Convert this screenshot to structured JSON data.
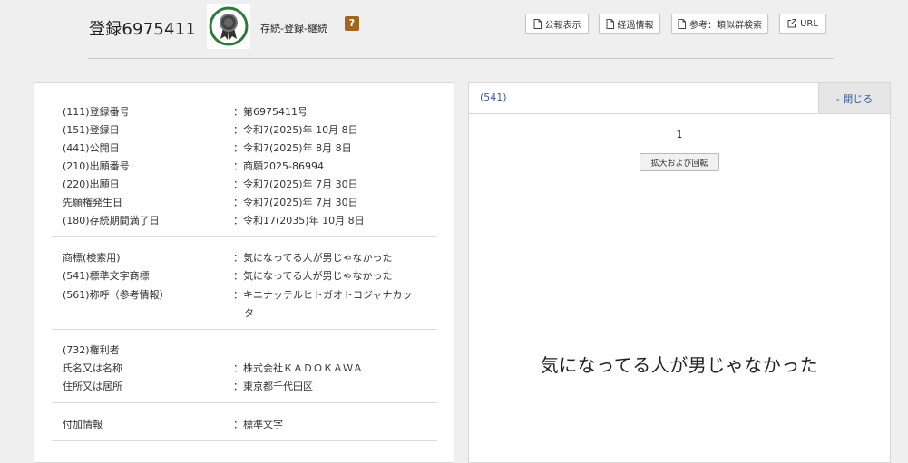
{
  "header": {
    "title": "登録6975411",
    "status": "存続-登録-継続",
    "help_label": "?",
    "buttons": {
      "gazette": "公報表示",
      "history": "経過情報",
      "similar": "参考：類似群検索",
      "url": "URL"
    }
  },
  "details": {
    "group1": [
      {
        "label": "(111)登録番号",
        "value": "：第6975411号"
      },
      {
        "label": "(151)登録日",
        "value": "：令和7(2025)年 10月 8日"
      },
      {
        "label": "(441)公開日",
        "value": "：令和7(2025)年 8月 8日"
      },
      {
        "label": "(210)出願番号",
        "value": "：商願2025-86994"
      },
      {
        "label": "(220)出願日",
        "value": "：令和7(2025)年 7月 30日"
      },
      {
        "label": "先願権発生日",
        "value": "：令和7(2025)年 7月 30日"
      },
      {
        "label": "(180)存続期間満了日",
        "value": "：令和17(2035)年 10月 8日"
      }
    ],
    "group2": [
      {
        "label": "商標(検索用)",
        "value": "：気になってる人が男じゃなかった"
      },
      {
        "label": "(541)標準文字商標",
        "value": "：気になってる人が男じゃなかった"
      },
      {
        "label": "(561)称呼（参考情報）",
        "value": "：キニナッテルヒトガオトコジャナカッ",
        "value_cont": "タ"
      }
    ],
    "group3": {
      "heading": "(732)権利者",
      "rows": [
        {
          "label": "氏名又は名称",
          "value": "：株式会社ＫＡＤＯＫＡＷＡ"
        },
        {
          "label": "住所又は居所",
          "value": "：東京都千代田区"
        }
      ]
    },
    "group4": [
      {
        "label": "付加情報",
        "value": "：標準文字"
      }
    ]
  },
  "image_panel": {
    "code": "(541)",
    "close_label": "- 閉じる",
    "page_number": "1",
    "zoom_label": "拡大および回転",
    "mark_text": "気になってる人が男じゃなかった"
  },
  "colors": {
    "background": "#efefef",
    "link": "#3a5d94",
    "help_badge": "#a0651e",
    "badge_ring": "#2f7a3b"
  },
  "icons": [
    "award-badge-icon",
    "document-icon",
    "external-link-icon"
  ]
}
